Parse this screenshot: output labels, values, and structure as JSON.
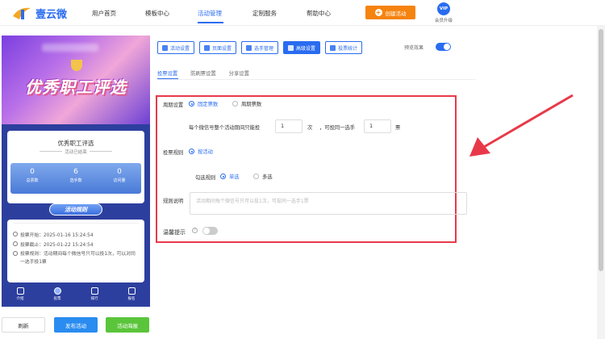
{
  "header": {
    "logo_text": "壹云微",
    "nav": [
      "用户首页",
      "模板中心",
      "活动管理",
      "定制服务",
      "帮助中心"
    ],
    "active_nav": "活动管理",
    "create_button": "创建活动",
    "vip_badge": "VIP",
    "vip_label": "会员升级"
  },
  "preview_phone": {
    "banner_title": "优秀职工评选",
    "activity_name": "优秀职工评选",
    "status": "活动已结束",
    "stats": [
      {
        "value": "0",
        "label": "总票数"
      },
      {
        "value": "6",
        "label": "选手数"
      },
      {
        "value": "0",
        "label": "访问量"
      }
    ],
    "rules_title": "活动规则",
    "info": {
      "start": "投票开始：2025-01-16 15:24:54",
      "end": "投票截止：2025-01-22 15:24:54",
      "rule": "投票规则：活动期间每个微信号只可以投1次，可以对同一选手投1票"
    },
    "bottom_nav": [
      "介绍",
      "投票",
      "排行",
      "报名"
    ],
    "active_bottom_nav": "投票"
  },
  "actions": {
    "refresh": "刷新",
    "publish": "发布活动",
    "poster": "活动海报"
  },
  "top_tabs": [
    "活动设置",
    "页面设置",
    "选手管理",
    "高级设置",
    "投票统计"
  ],
  "active_top_tab": "高级设置",
  "preview_effect_label": "预览效果",
  "preview_effect_on": true,
  "sub_tabs": [
    "投票设置",
    "防刷票设置",
    "分享设置"
  ],
  "active_sub_tab": "投票设置",
  "form": {
    "cycle_label": "周期设置",
    "cycle_options": [
      "固定票数",
      "周期票数"
    ],
    "cycle_selected": "固定票数",
    "per_wechat_prefix": "每个微信号整个活动期间只能投",
    "per_wechat_value": "1",
    "per_wechat_unit": "次",
    "same_player_prefix": "，可投同一选手",
    "same_player_value": "1",
    "same_player_unit": "票",
    "vote_rule_label": "投票规则",
    "vote_rule_option": "按活动",
    "check_rule_label": "勾选规则",
    "check_options": [
      "单选",
      "多选"
    ],
    "check_selected": "单选",
    "rule_desc_label": "规则说明",
    "rule_desc_placeholder": "活动期间每个微信号只可以投1次，可投同一选手1票",
    "reminder_label": "温馨提示",
    "reminder_help": "?",
    "reminder_on": false
  },
  "colors": {
    "primary": "#2a6cf0",
    "highlight_box": "#e8394a",
    "create_button": "#f5830f",
    "poster_button": "#5ac53a"
  }
}
